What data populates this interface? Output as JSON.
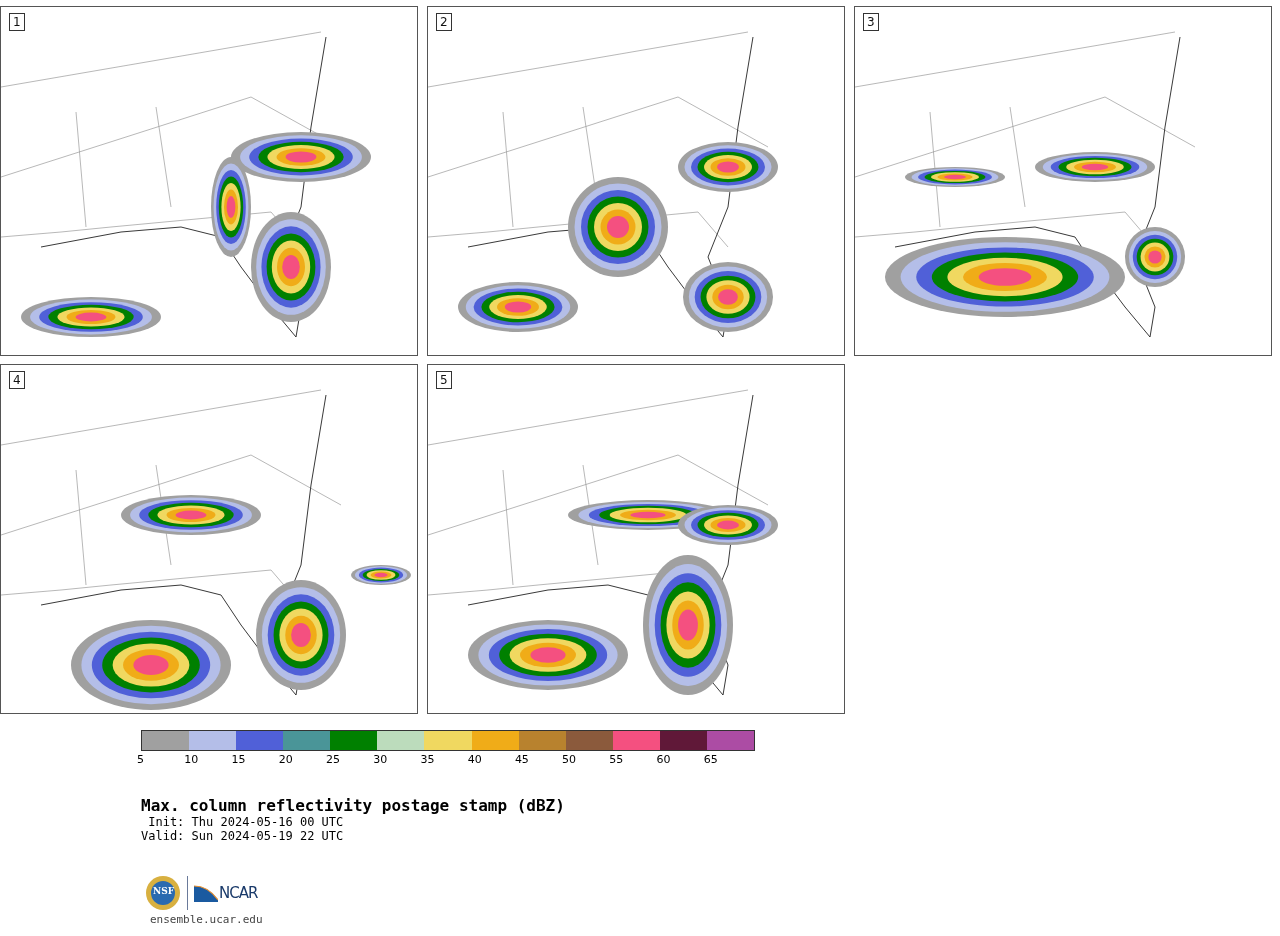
{
  "panels": [
    {
      "label": "1"
    },
    {
      "label": "2"
    },
    {
      "label": "3"
    },
    {
      "label": "4"
    },
    {
      "label": "5"
    }
  ],
  "colorbar": {
    "segments": [
      {
        "label": "5",
        "color": "#a0a0a0"
      },
      {
        "label": "10",
        "color": "#b4bee8"
      },
      {
        "label": "15",
        "color": "#5060d8"
      },
      {
        "label": "20",
        "color": "#4a9598"
      },
      {
        "label": "25",
        "color": "#008000"
      },
      {
        "label": "30",
        "color": "#bcdcbc"
      },
      {
        "label": "35",
        "color": "#f0d860"
      },
      {
        "label": "40",
        "color": "#f0ac18"
      },
      {
        "label": "45",
        "color": "#b8822e"
      },
      {
        "label": "50",
        "color": "#8b5a3c"
      },
      {
        "label": "55",
        "color": "#f45080"
      },
      {
        "label": "60",
        "color": "#601838"
      },
      {
        "label": "65",
        "color": "#ac4ca4"
      }
    ]
  },
  "title": "Max. column reflectivity postage stamp (dBZ)",
  "init": " Init: Thu 2024-05-16 00 UTC",
  "valid": "Valid: Sun 2024-05-19 22 UTC",
  "logos": {
    "nsf": "NSF",
    "ncar": "NCAR"
  },
  "footer": "ensemble.ucar.edu"
}
